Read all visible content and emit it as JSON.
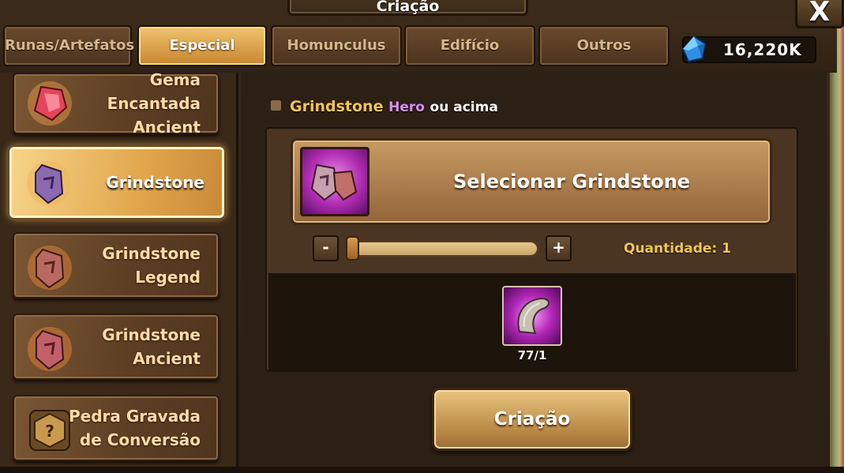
{
  "window": {
    "title": "Criação",
    "close_label": "X"
  },
  "tabs": [
    {
      "label": "Runas/Artefatos",
      "active": false
    },
    {
      "label": "Especial",
      "active": true
    },
    {
      "label": "Homunculus",
      "active": false
    },
    {
      "label": "Edifício",
      "active": false
    },
    {
      "label": "Outros",
      "active": false
    }
  ],
  "currency": {
    "icon": "crystal-icon",
    "value": "16,220K",
    "color": "#3aa7f5"
  },
  "items": [
    {
      "line1": "Gema",
      "line2": "Encantada",
      "line3": "Ancient",
      "icon": "enchanted-gem-icon"
    },
    {
      "line1": "Grindstone",
      "icon": "grindstone-icon",
      "selected": true
    },
    {
      "line1": "Grindstone",
      "line2": "Legend",
      "icon": "grindstone-legend-icon"
    },
    {
      "line1": "Grindstone",
      "line2": "Ancient",
      "icon": "grindstone-ancient-icon"
    },
    {
      "line1": "Pedra Gravada",
      "line2": "de Conversão",
      "icon": "conversion-stone-icon"
    }
  ],
  "filter": {
    "name": "Grindstone",
    "grade": "Hero",
    "suffix": "ou acima"
  },
  "selector": {
    "label": "Selecionar Grindstone",
    "icon": "grindstone-pair-icon"
  },
  "quantity": {
    "minus": "-",
    "plus": "+",
    "label": "Quantidade: 1",
    "slider_fraction": 0
  },
  "materials": [
    {
      "icon": "claw-material-icon",
      "count": "77/1"
    }
  ],
  "craft_button": {
    "label": "Criação"
  }
}
